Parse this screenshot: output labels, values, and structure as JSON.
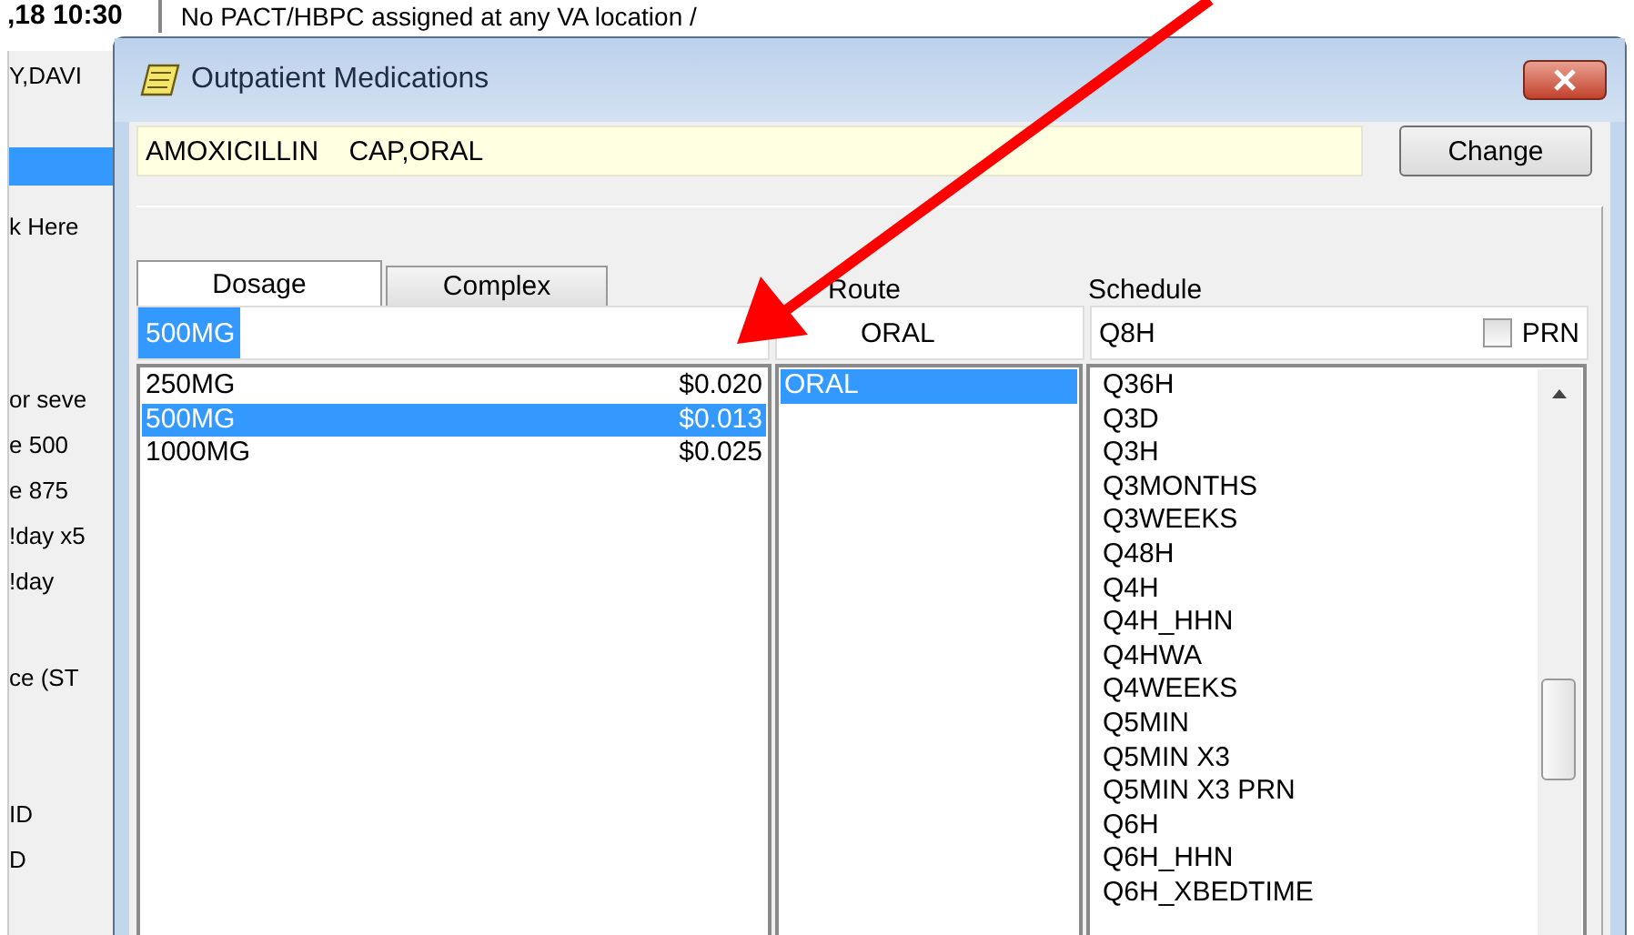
{
  "background": {
    "header_time": ",18 10:30",
    "header_note": "No PACT/HBPC assigned at any VA location /",
    "patient": "Y,DAVI",
    "left_texts": [
      "k Here",
      "or seve",
      "e 500",
      "e 875",
      "!day x5",
      "!day",
      "ce (ST",
      "ID",
      "D"
    ]
  },
  "dialog": {
    "title": "Outpatient Medications",
    "drug": "AMOXICILLIN    CAP,ORAL",
    "change_button": "Change",
    "tabs": [
      {
        "label": "Dosage",
        "selected": true
      },
      {
        "label": "Complex",
        "selected": false
      }
    ],
    "route_label": "Route",
    "schedule_label": "Schedule",
    "dosage_value": "500MG",
    "route_value": "ORAL",
    "schedule_value": "Q8H",
    "prn": {
      "label": "PRN",
      "checked": false
    },
    "dosages": [
      {
        "dose": "250MG",
        "price": "$0.020",
        "selected": false
      },
      {
        "dose": "500MG",
        "price": "$0.013",
        "selected": true
      },
      {
        "dose": "1000MG",
        "price": "$0.025",
        "selected": false
      }
    ],
    "routes": [
      {
        "name": "ORAL",
        "selected": true
      }
    ],
    "schedules": [
      {
        "name": "Q36H",
        "selected": false
      },
      {
        "name": "Q3D",
        "selected": false
      },
      {
        "name": "Q3H",
        "selected": false
      },
      {
        "name": "Q3MONTHS",
        "selected": false
      },
      {
        "name": "Q3WEEKS",
        "selected": false
      },
      {
        "name": "Q48H",
        "selected": false
      },
      {
        "name": "Q4H",
        "selected": false
      },
      {
        "name": "Q4H_HHN",
        "selected": false
      },
      {
        "name": "Q4HWA",
        "selected": false
      },
      {
        "name": "Q4WEEKS",
        "selected": false
      },
      {
        "name": "Q5MIN",
        "selected": false
      },
      {
        "name": "Q5MIN X3",
        "selected": false
      },
      {
        "name": "Q5MIN X3 PRN",
        "selected": false
      },
      {
        "name": "Q6H",
        "selected": false
      },
      {
        "name": "Q6H_HHN",
        "selected": false
      },
      {
        "name": "Q6H_XBEDTIME",
        "selected": false
      }
    ]
  }
}
